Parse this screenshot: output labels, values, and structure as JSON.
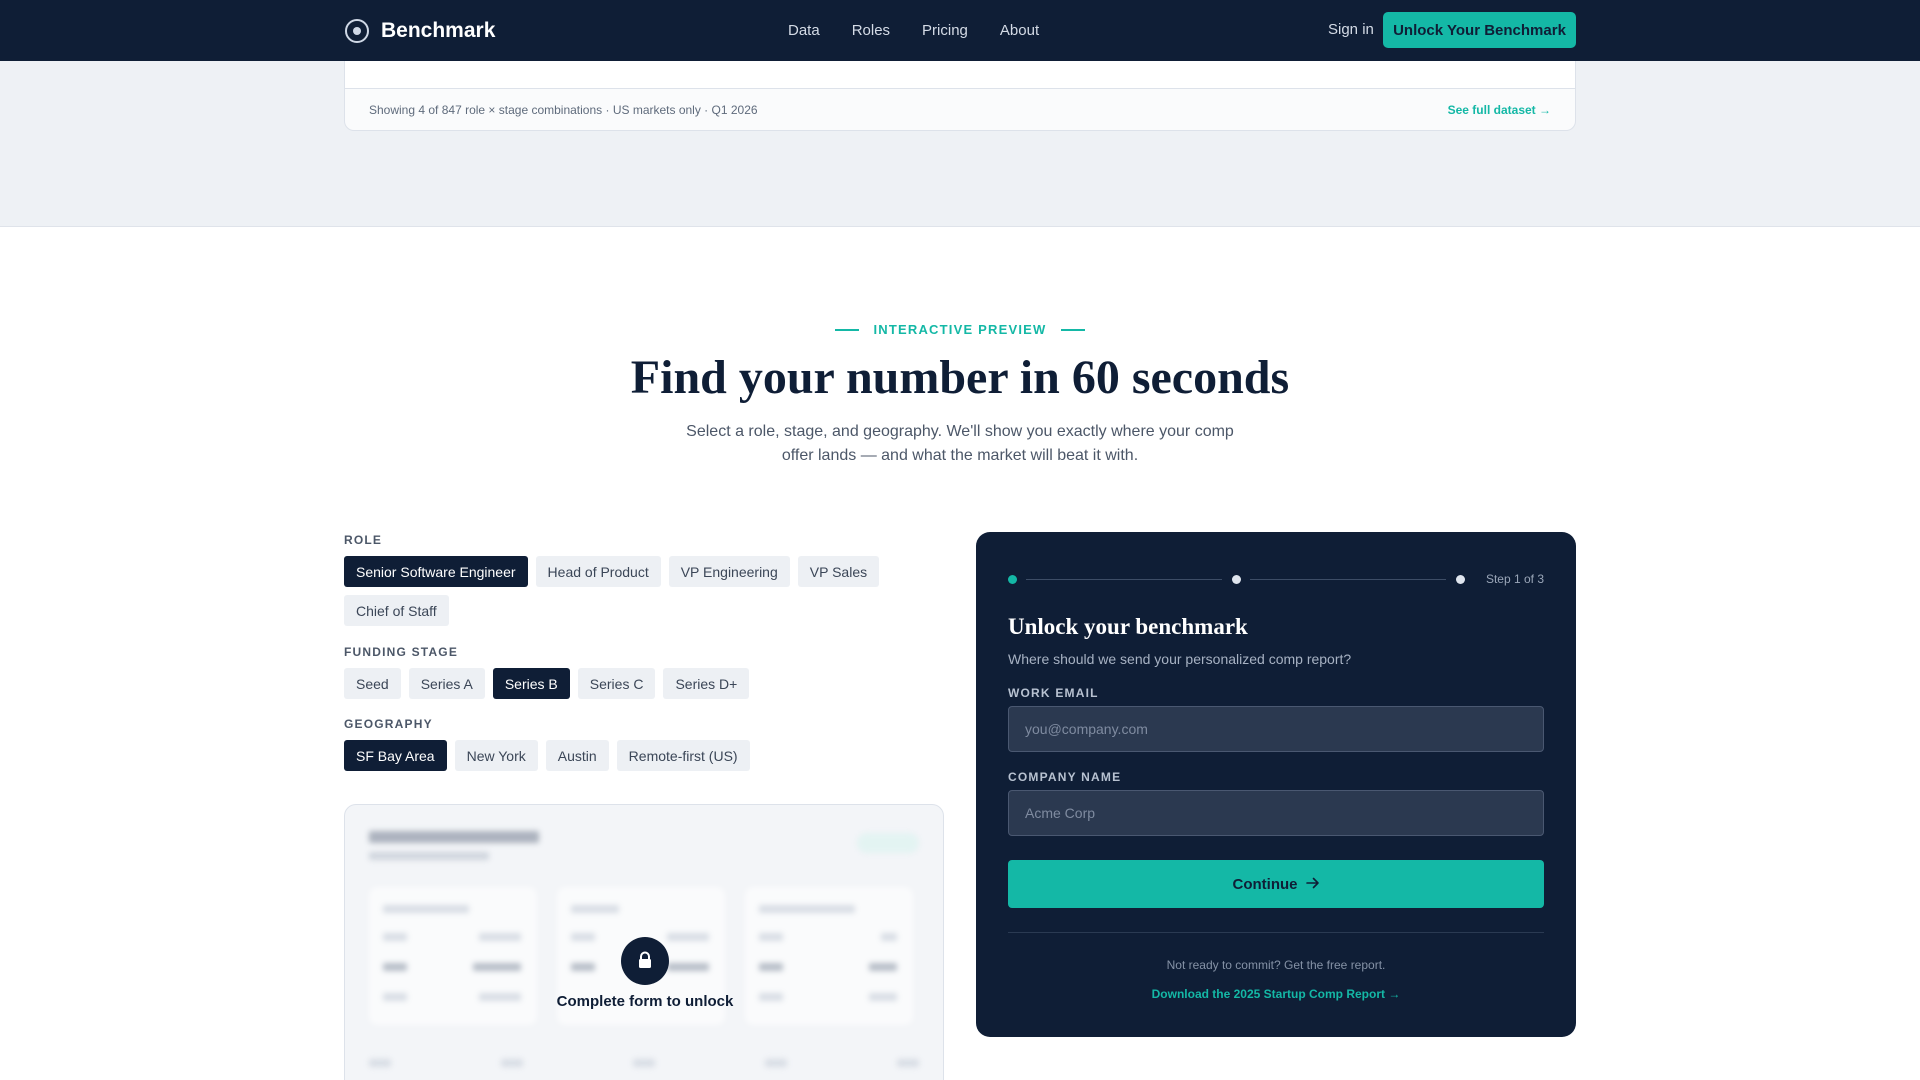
{
  "nav": {
    "brand": "Benchmark",
    "links": [
      "Data",
      "Roles",
      "Pricing",
      "About"
    ],
    "signin": "Sign in",
    "cta": "Unlock Your Benchmark"
  },
  "dataset": {
    "summary": "Showing 4 of 847 role × stage combinations · US markets only · Q1 2026",
    "link": "See full dataset →"
  },
  "section": {
    "eyebrow": "INTERACTIVE PREVIEW",
    "title": "Find your number in 60 seconds",
    "subtitle": "Select a role, stage, and geography. We'll show you exactly where your comp offer lands — and what the market will beat it with."
  },
  "selectors": {
    "role": {
      "label": "ROLE",
      "options": [
        "Senior Software Engineer",
        "Head of Product",
        "VP Engineering",
        "VP Sales",
        "Chief of Staff"
      ],
      "selected": "Senior Software Engineer"
    },
    "stage": {
      "label": "FUNDING STAGE",
      "options": [
        "Seed",
        "Series A",
        "Series B",
        "Series C",
        "Series D+"
      ],
      "selected": "Series B"
    },
    "geo": {
      "label": "GEOGRAPHY",
      "options": [
        "SF Bay Area",
        "New York",
        "Austin",
        "Remote-first (US)"
      ],
      "selected": "SF Bay Area"
    }
  },
  "preview": {
    "lock_text": "Complete form to unlock"
  },
  "form": {
    "step_label": "Step 1 of 3",
    "title": "Unlock your benchmark",
    "subtitle": "Where should we send your personalized comp report?",
    "email_label": "WORK EMAIL",
    "email_placeholder": "you@company.com",
    "company_label": "COMPANY NAME",
    "company_placeholder": "Acme Corp",
    "continue": "Continue",
    "free_text": "Not ready to commit? Get the free report.",
    "free_link": "Download the 2025 Startup Comp Report →"
  },
  "colors": {
    "navy": "#0f1e36",
    "accent": "#14b8a6"
  }
}
